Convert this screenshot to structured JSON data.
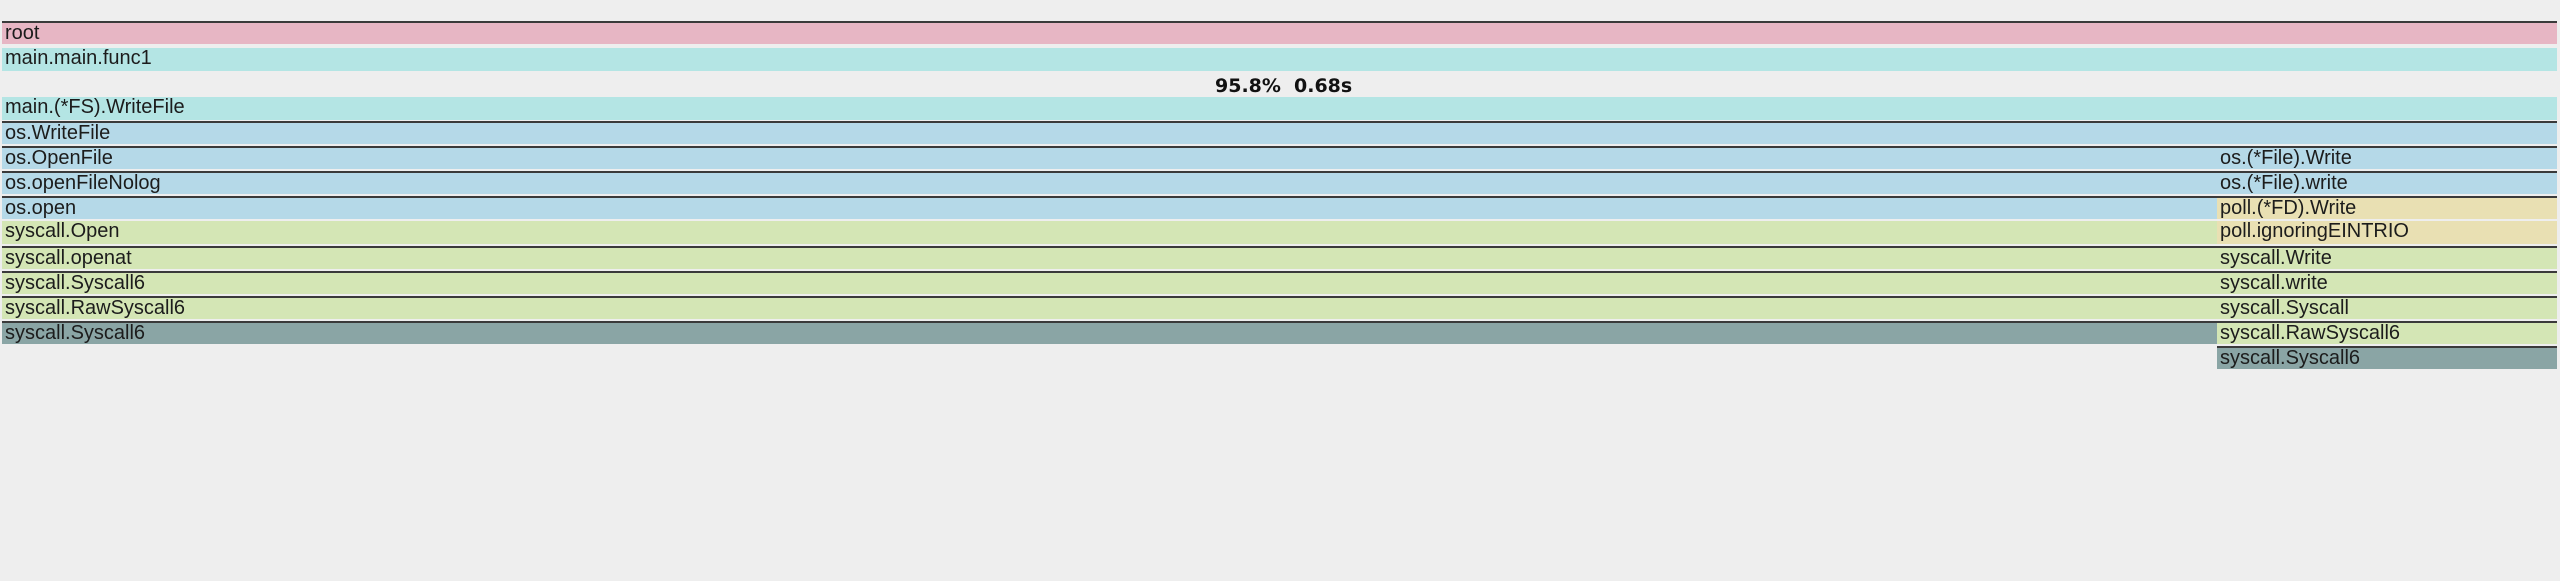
{
  "colors": {
    "pink": "#e7b6c4",
    "teal": "#b4e5e4",
    "blue": "#b5d9e8",
    "green": "#d4e6b5",
    "yellow": "#e9e0b3",
    "dark": "#8aa5a5"
  },
  "header": {
    "percent": "95.8%",
    "duration": "0.68s"
  },
  "frames": {
    "root": "root",
    "main_func1": "main.main.func1",
    "fs_writefile": "main.(*FS).WriteFile",
    "os_writefile": "os.WriteFile",
    "left": {
      "os_openfile": "os.OpenFile",
      "os_openfilenolog": "os.openFileNolog",
      "os_open": "os.open",
      "syscall_open": "syscall.Open",
      "syscall_openat": "syscall.openat",
      "syscall_syscall6": "syscall.Syscall6",
      "syscall_rawsyscall6": "syscall.RawSyscall6",
      "syscall_syscall6_leaf": "syscall.Syscall6"
    },
    "right": {
      "file_write": "os.(*File).Write",
      "file_write_lower": "os.(*File).write",
      "fd_write": "poll.(*FD).Write",
      "ignoring_eintr": "poll.ignoringEINTRIO",
      "syscall_write": "syscall.Write",
      "syscall_write_lower": "syscall.write",
      "syscall_syscall": "syscall.Syscall",
      "syscall_rawsyscall6": "syscall.RawSyscall6",
      "syscall_syscall6_leaf": "syscall.Syscall6"
    }
  }
}
